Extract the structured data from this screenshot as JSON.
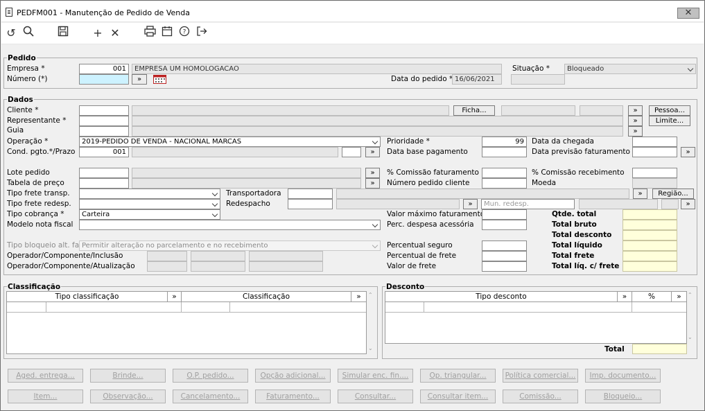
{
  "window": {
    "title": "PEDFM001 - Manutenção de Pedido de Venda",
    "close_label": "✕"
  },
  "toolbar": {
    "icons": [
      "undo-icon",
      "search-icon",
      "save-icon",
      "add-icon",
      "delete-icon",
      "print-icon",
      "calendar-icon",
      "help-icon",
      "exit-icon"
    ]
  },
  "pedido": {
    "group_title": "Pedido",
    "empresa_label": "Empresa *",
    "empresa_code": "001",
    "empresa_name": "EMPRESA UM HOMOLOGACAO",
    "numero_label": "Número (*)",
    "numero_value": "",
    "data_label": "Data do pedido *",
    "data_value": "16/06/2021",
    "situacao_label": "Situação *",
    "situacao_value": "Bloqueado"
  },
  "dados": {
    "group_title": "Dados",
    "cliente_label": "Cliente *",
    "representante_label": "Representante *",
    "guia_label": "Guia",
    "operacao_label": "Operação *",
    "operacao_value": "2019-PEDIDO DE VENDA - NACIONAL MARCAS",
    "cond_label": "Cond. pgto.*/Prazo",
    "cond_value": "001",
    "lote_label": "Lote pedido",
    "tabela_label": "Tabela de preço",
    "tipo_frete_label": "Tipo frete transp.",
    "tipo_frete_redesp_label": "Tipo frete redesp.",
    "tipo_cobranca_label": "Tipo cobrança *",
    "tipo_cobranca_value": "Carteira",
    "modelo_nf_label": "Modelo nota fiscal",
    "tipo_bloqueio_label": "Tipo bloqueio alt. fat.",
    "tipo_bloqueio_value": "Permitir alteração no parcelamento e no recebimento",
    "op_inclusao_label": "Operador/Componente/Inclusão",
    "op_atualizacao_label": "Operador/Componente/Atualização",
    "transportadora_label": "Transportadora",
    "redespacho_label": "Redespacho",
    "mun_redesp_label": "Mun. redesp.",
    "ficha_button": "Ficha...",
    "pessoa_button": "Pessoa...",
    "limite_button": "Limite...",
    "regiao_button": "Região...",
    "prioridade_label": "Prioridade *",
    "prioridade_value": "99",
    "data_base_label": "Data base pagamento",
    "comissao_fat_label": "% Comissão faturamento",
    "numero_pedido_cliente_label": "Número pedido cliente",
    "valor_max_label": "Valor máximo faturamento",
    "perc_despesa_label": "Perc. despesa acessória",
    "perc_seguro_label": "Percentual seguro",
    "perc_frete_label": "Percentual de frete",
    "valor_frete_label": "Valor de frete",
    "data_chegada_label": "Data da chegada",
    "data_prev_label": "Data previsão faturamento",
    "comissao_rec_label": "% Comissão recebimento",
    "moeda_label": "Moeda",
    "qtde_total_label": "Qtde. total",
    "total_bruto_label": "Total bruto",
    "total_desconto_label": "Total desconto",
    "total_liquido_label": "Total líquido",
    "total_frete_label": "Total frete",
    "total_liq_frete_label": "Total líq. c/ frete"
  },
  "classificacao": {
    "group_title": "Classificação",
    "columns": [
      "Tipo classificação",
      "Classificação"
    ]
  },
  "desconto": {
    "group_title": "Desconto",
    "columns": [
      "Tipo desconto",
      "%"
    ],
    "total_label": "Total"
  },
  "more_label": "»",
  "buttons_row1": [
    "Aged. entrega...",
    "Brinde...",
    "O.P. pedido...",
    "Opção adicional...",
    "Simular enc. fin....",
    "Op. triangular...",
    "Política comercial...",
    "Imp. documento..."
  ],
  "buttons_row2": [
    "Item...",
    "Observação...",
    "Cancelamento...",
    "Faturamento...",
    "Consultar...",
    "Consultar item...",
    "Comissão...",
    "Bloqueio..."
  ]
}
